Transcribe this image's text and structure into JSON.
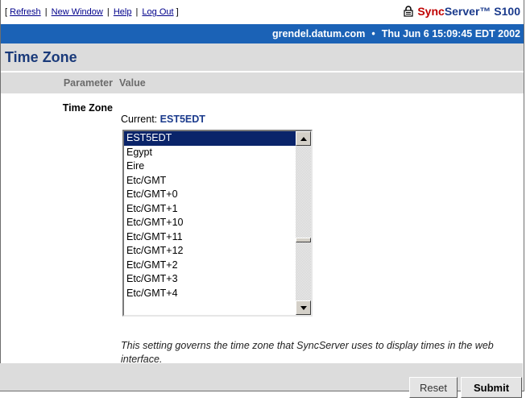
{
  "toplinks": {
    "open": "[",
    "refresh": "Refresh",
    "sep": "|",
    "new_window": "New Window",
    "help": "Help",
    "logout": "Log Out",
    "close": "]"
  },
  "brand": {
    "prefix": "Sync",
    "name": "Server™ S100"
  },
  "status": {
    "host": "grendel.datum.com",
    "dot": "•",
    "datetime": "Thu Jun 6 15:09:45 EDT 2002"
  },
  "page_title": "Time Zone",
  "table_head": {
    "parameter": "Parameter",
    "value": "Value"
  },
  "time_zone": {
    "label": "Time Zone",
    "current_label": "Current:",
    "current_value": "EST5EDT",
    "options": [
      "EST5EDT",
      "Egypt",
      "Eire",
      "Etc/GMT",
      "Etc/GMT+0",
      "Etc/GMT+1",
      "Etc/GMT+10",
      "Etc/GMT+11",
      "Etc/GMT+12",
      "Etc/GMT+2",
      "Etc/GMT+3",
      "Etc/GMT+4"
    ],
    "selected_index": 0,
    "help": "This setting governs the time zone that SyncServer uses to display times in the web interface."
  },
  "buttons": {
    "reset": "Reset",
    "submit": "Submit"
  }
}
